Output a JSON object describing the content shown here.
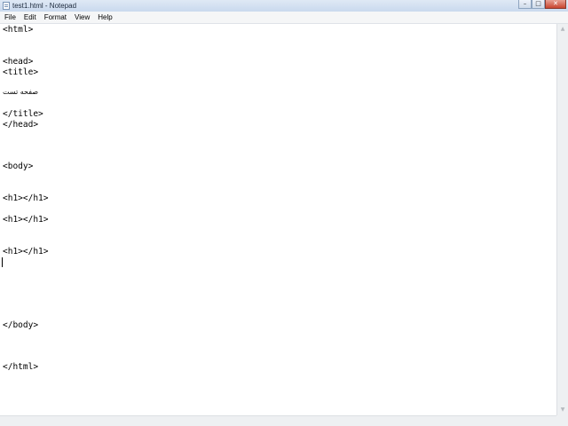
{
  "window": {
    "title": "test1.html - Notepad",
    "controls": {
      "minimize_glyph": "–",
      "maximize_glyph": "□",
      "close_glyph": "✕"
    }
  },
  "menu": {
    "file": "File",
    "edit": "Edit",
    "format": "Format",
    "view": "View",
    "help": "Help"
  },
  "editor": {
    "lines": [
      "<html>",
      "<head>",
      "<title>",
      "صفحه تست",
      "</title>",
      "</head>",
      "<body>",
      "<h1></h1>",
      "<h1></h1>",
      "<h1></h1>",
      "</body>",
      "</html>"
    ]
  },
  "scrollbar": {
    "up_arrow_icon": "▲",
    "down_arrow_icon": "▼"
  },
  "colors": {
    "titlebar": "#c9d9ee",
    "close_button": "#c8452f",
    "editor_background": "#ffffff"
  }
}
